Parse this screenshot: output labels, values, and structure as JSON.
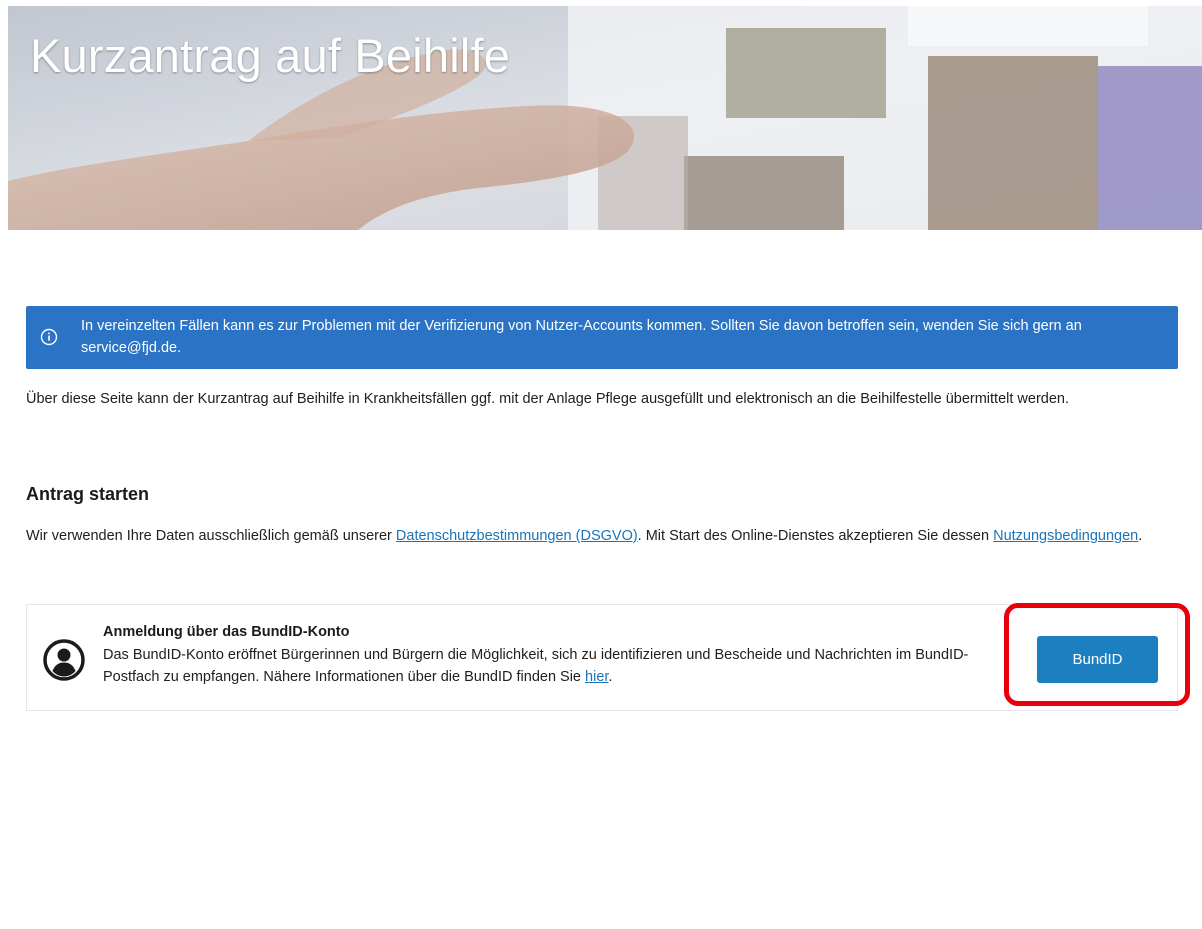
{
  "header": {
    "title": "Kurzantrag auf Beihilfe"
  },
  "alert": {
    "icon": "info-icon",
    "text": "In vereinzelten Fällen kann es zur Problemen mit der Verifizierung von Nutzer-Accounts kommen. Sollten Sie davon betroffen sein, wenden Sie sich gern an service@fjd.de.",
    "color": "#2a73c5"
  },
  "intro": {
    "text": "Über diese Seite kann der Kurzantrag auf Beihilfe in Krankheitsfällen ggf. mit der Anlage Pflege ausgefüllt und elektronisch an die Beihilfestelle übermittelt werden."
  },
  "start": {
    "heading": "Antrag starten",
    "privacy_prefix": "Wir verwenden Ihre Daten ausschließlich gemäß unserer ",
    "privacy_link": "Datenschutzbestimmungen (DSGVO)",
    "privacy_middle": ". Mit Start des Online-Dienstes akzeptieren Sie dessen ",
    "terms_link": "Nutzungsbedingungen",
    "privacy_suffix": "."
  },
  "login_card": {
    "icon": "user-circle-icon",
    "title": "Anmeldung über das BundID-Konto",
    "desc_prefix": "Das BundID-Konto eröffnet Bürgerinnen und Bürgern die Möglichkeit, sich zu identifizieren und Bescheide und Nachrichten im BundID-Postfach zu empfangen. Nähere Informationen über die BundID finden Sie ",
    "desc_link": "hier",
    "desc_suffix": ".",
    "button_label": "BundID",
    "button_color": "#1c7fc0"
  },
  "annotation": {
    "highlight_color": "#e8000b"
  }
}
